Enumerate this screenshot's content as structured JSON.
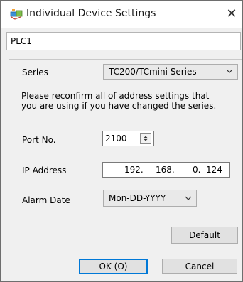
{
  "window": {
    "title": "Individual Device Settings",
    "close_glyph": "✕"
  },
  "device": {
    "name": "PLC1"
  },
  "form": {
    "series_label": "Series",
    "series_value": "TC200/TCmini Series",
    "note_line1": "Please reconfirm all of address settings that",
    "note_line2": "you are using if you have changed the series.",
    "port_label": "Port No.",
    "port_value": "2100",
    "ip_label": "IP Address",
    "ip_octets": [
      "192.",
      "168.",
      "0.",
      "124"
    ],
    "alarm_label": "Alarm Date",
    "alarm_value": "Mon-DD-YYYY"
  },
  "buttons": {
    "default": "Default",
    "ok": "OK (O)",
    "cancel": "Cancel"
  },
  "icons": {
    "app": "network-devices-icon",
    "close": "close-icon",
    "dropdown": "chevron-down-icon",
    "spinner": "spinner-icon"
  },
  "colors": {
    "focus_border": "#0078d7",
    "window_bg": "#f0f0f0"
  }
}
